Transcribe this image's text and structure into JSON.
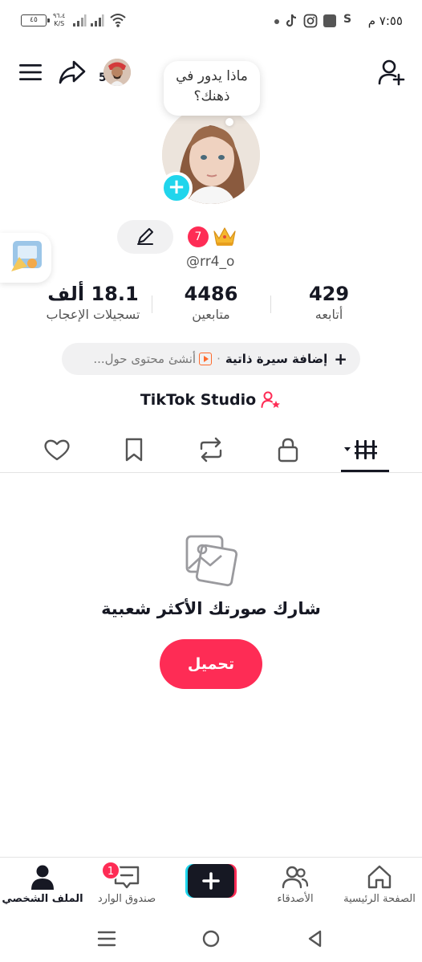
{
  "status_bar": {
    "time": "٧:٥٥ م",
    "battery": "٤٥",
    "speed_value": "٩٦،٤",
    "speed_unit": "K/S",
    "icons": [
      "wifi-icon",
      "signal-icon",
      "signal-icon",
      "s-icon",
      "gallery-icon",
      "instagram-icon",
      "tiktok-icon",
      "dot-icon"
    ]
  },
  "header": {
    "story_count": "5",
    "bubble_line1": "ماذا يدور في",
    "bubble_line2": "ذهنك؟",
    "icons": [
      "menu-icon",
      "share-icon",
      "add-friend-icon"
    ]
  },
  "profile": {
    "notification_count": "7",
    "username": "@rr4_o",
    "stats": {
      "following": {
        "value": "429",
        "label": "أتابعه"
      },
      "followers": {
        "value": "4486",
        "label": "متابعين"
      },
      "likes": {
        "value": "18.1 ألف",
        "label": "تسجيلات الإعجاب"
      }
    },
    "bio_add": "إضافة سيرة ذاتية",
    "bio_separator": "·",
    "bio_create": "أنشئ محتوى حول...",
    "studio": "TikTok Studio"
  },
  "tabs": [
    "videos-tab",
    "private-tab",
    "repost-tab",
    "favorites-tab",
    "liked-tab"
  ],
  "empty_state": {
    "title": "شارك صورتك الأكثر شعبية",
    "upload": "تحميل"
  },
  "bottom_nav": {
    "home": "الصفحة الرئيسية",
    "friends": "الأصدقاء",
    "inbox": "صندوق الوارد",
    "inbox_badge": "1",
    "profile": "الملف الشخصي"
  },
  "colors": {
    "accent": "#fe2c55",
    "cyan": "#20d5ec",
    "text": "#161823"
  }
}
